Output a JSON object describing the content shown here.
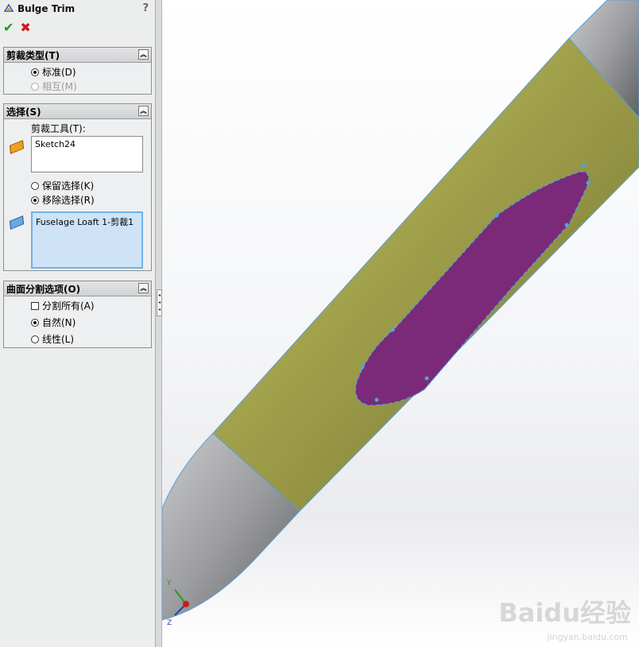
{
  "panel": {
    "title": "Bulge Trim",
    "help": "?",
    "ok_symbol": "✔",
    "cancel_symbol": "✖"
  },
  "trim_type": {
    "header": "剪裁类型(T)",
    "options": [
      "标准(D)",
      "相互(M)"
    ],
    "selected": "标准(D)"
  },
  "selection": {
    "header": "选择(S)",
    "tool_label": "剪裁工具(T):",
    "tool_value": "Sketch24",
    "keep_label": "保留选择(K)",
    "remove_label": "移除选择(R)",
    "selected_mode": "移除选择(R)",
    "surface_value": "Fuselage Loaft 1-剪裁1"
  },
  "split_options": {
    "header": "曲面分割选项(O)",
    "split_all_label": "分割所有(A)",
    "natural_label": "自然(N)",
    "linear_label": "线性(L)",
    "selected": "自然(N)"
  },
  "triad": {
    "y": "Y",
    "z": "Z"
  },
  "watermark": {
    "main": "Baidu经验",
    "sub": "jingyan.baidu.com"
  },
  "colors": {
    "body_green": "#8a8a3a",
    "cutout_purple": "#7a2a78",
    "cap_gray": "#8e8f92",
    "sketch_blue": "#4aa6e8"
  }
}
